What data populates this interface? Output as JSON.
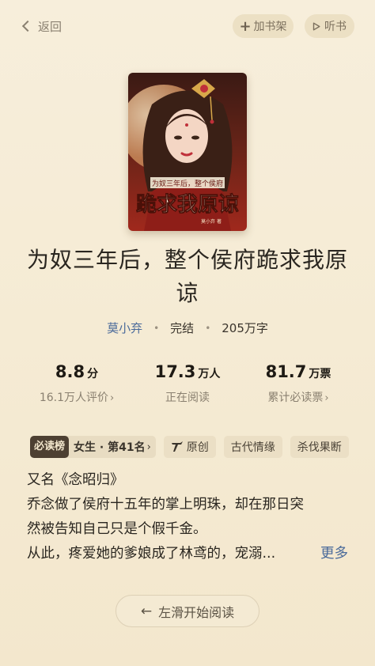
{
  "topbar": {
    "back_label": "返回",
    "add_shelf_label": "加书架",
    "listen_label": "听书"
  },
  "book": {
    "cover": {
      "title_text": "跪求我原谅",
      "subtitle_text": "为奴三年后，整个侯府",
      "author_text": "莫小弃 著"
    },
    "title": "为奴三年后，整个侯府跪求我原谅",
    "author": "莫小弃",
    "status": "完结",
    "word_count": "205万字"
  },
  "stats": [
    {
      "value": "8.8",
      "unit": "分",
      "label": "16.1万人评价"
    },
    {
      "value": "17.3",
      "unit": "万人",
      "label": "正在阅读"
    },
    {
      "value": "81.7",
      "unit": "万票",
      "label": "累计必读票"
    }
  ],
  "tags": {
    "rank_badge": "必读榜",
    "rank_text": "女生 · 第41名",
    "items": [
      "原创",
      "古代情缘",
      "杀伐果断"
    ]
  },
  "description": {
    "line1": "又名《念昭归》",
    "line2": "乔念做了侯府十五年的掌上明珠，却在那日突",
    "line3": "然被告知自己只是个假千金。",
    "line4": "从此，疼爱她的爹娘成了林鸢的，宠溺...",
    "more_label": "更多"
  },
  "start_reading_label": "左滑开始阅读",
  "colors": {
    "background": "#f6ecd6",
    "accent_link": "#4a6a9a",
    "badge_dark": "#4d4032"
  }
}
